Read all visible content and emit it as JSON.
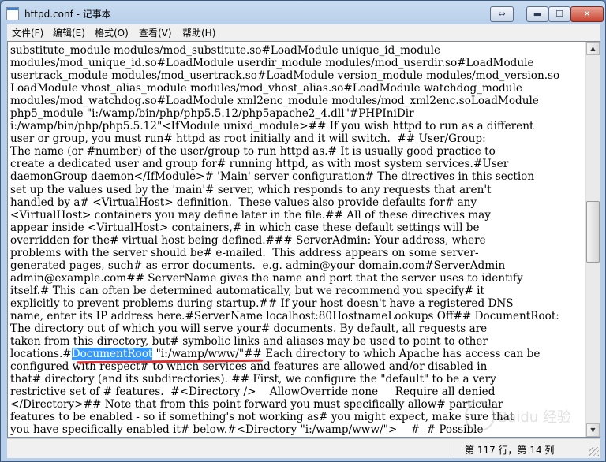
{
  "window": {
    "title": "httpd.conf - 记事本",
    "controls": {
      "restore": "⇔",
      "minimize": "▬",
      "maximize": "☐",
      "close": "✕"
    }
  },
  "menu": [
    "文件(F)",
    "编辑(E)",
    "格式(O)",
    "查看(V)",
    "帮助(H)"
  ],
  "editor": {
    "before": "substitute_module modules/mod_substitute.so#LoadModule unique_id_module\nmodules/mod_unique_id.so#LoadModule userdir_module modules/mod_userdir.so#LoadModule\nusertrack_module modules/mod_usertrack.so#LoadModule version_module modules/mod_version.so\nLoadModule vhost_alias_module modules/mod_vhost_alias.so#LoadModule watchdog_module\nmodules/mod_watchdog.so#LoadModule xml2enc_module modules/mod_xml2enc.soLoadModule\nphp5_module \"i:/wamp/bin/php/php5.5.12/php5apache2_4.dll\"#PHPIniDir\ni:/wamp/bin/php/php5.5.12\"<IfModule unixd_module>## If you wish httpd to run as a different\nuser or group, you must run# httpd as root initially and it will switch.  ## User/Group:\nThe name (or #number) of the user/group to run httpd as.# It is usually good practice to\ncreate a dedicated user and group for# running httpd, as with most system services.#User\ndaemonGroup daemon</IfModule># 'Main' server configuration# The directives in this section\nset up the values used by the 'main'# server, which responds to any requests that aren't\nhandled by a# <VirtualHost> definition.  These values also provide defaults for# any\n<VirtualHost> containers you may define later in the file.## All of these directives may\nappear inside <VirtualHost> containers,# in which case these default settings will be\noverridden for the# virtual host being defined.### ServerAdmin: Your address, where\nproblems with the server should be# e-mailed.  This address appears on some server-\ngenerated pages, such# as error documents.  e.g. admin@your-domain.com#ServerAdmin\nadmin@example.com## ServerName gives the name and port that the server uses to identify\nitself.# This can often be determined automatically, but we recommend you specify# it\nexplicitly to prevent problems during startup.## If your host doesn't have a registered DNS\nname, enter its IP address here.#ServerName localhost:80HostnameLookups Off## DocumentRoot:\nThe directory out of which you will serve your# documents. By default, all requests are\ntaken from this directory, but# symbolic links and aliases may be used to point to other\nlocations.#",
    "selected": "DocumentRoot",
    "after": " \"i:/wamp/www/\"## Each directory to which Apache has access can be\nconfigured with respect# to which services and features are allowed and/or disabled in\nthat# directory (and its subdirectories). ## First, we configure the \"default\" to be a very\nrestrictive set of # features.  #<Directory />    AllowOverride none     Require all denied\n</Directory>## Note that from this point forward you must specifically allow# particular\nfeatures to be enabled - so if something's not working as# you might expect, make sure that\nyou have specifically enabled it# below.#<Directory \"i:/wamp/www/\">    #  # Possible"
  },
  "status": {
    "position": "第 117 行，第 14 列"
  },
  "watermark": "Baidu 经验"
}
